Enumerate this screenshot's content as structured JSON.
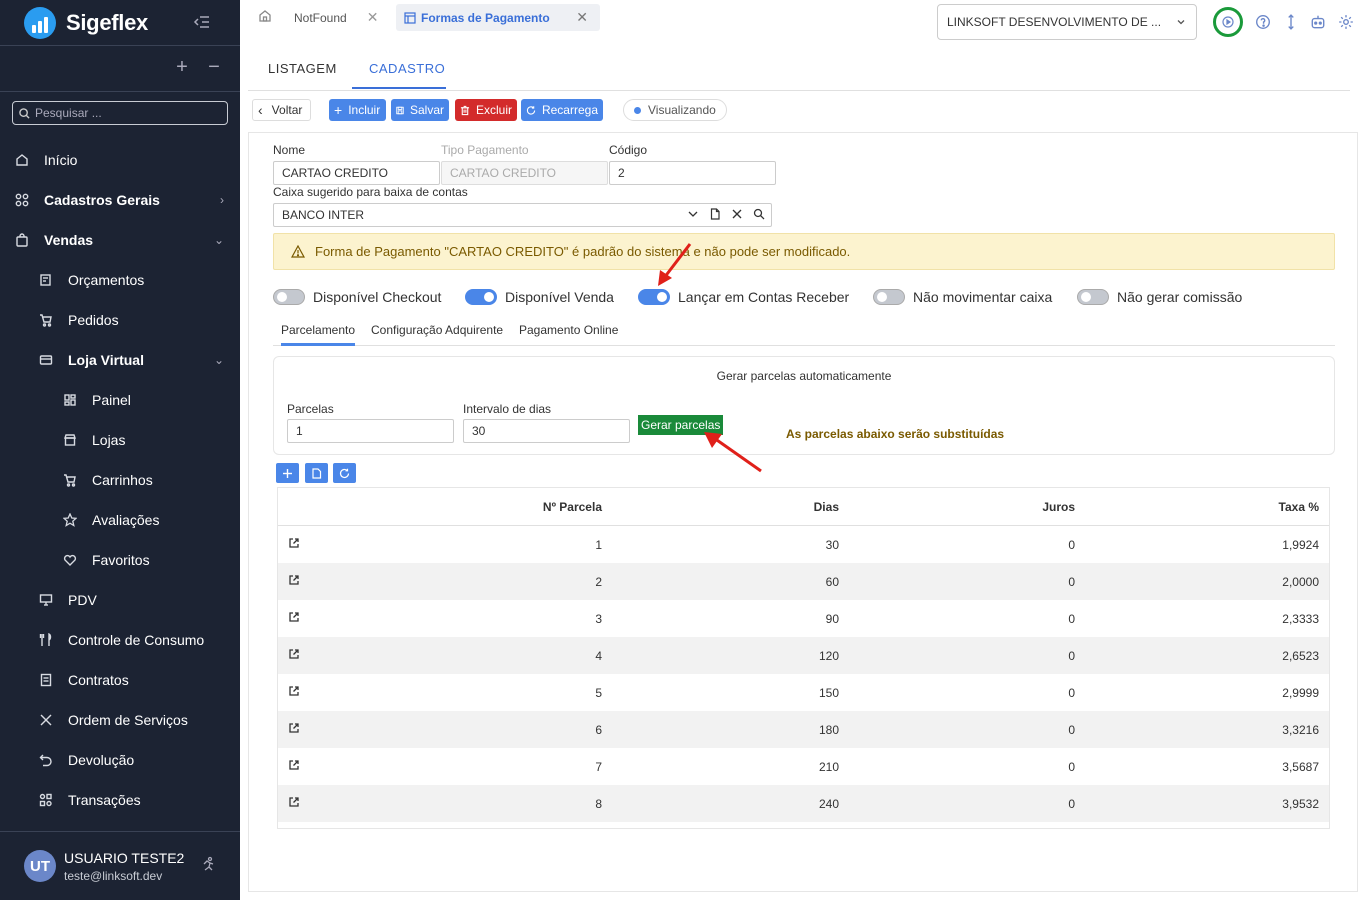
{
  "brand": {
    "name": "Sigeflex"
  },
  "sidebar": {
    "search_placeholder": "Pesquisar ...",
    "items": [
      {
        "label": "Início",
        "icon": "home-icon"
      },
      {
        "label": "Cadastros Gerais",
        "icon": "grid-icon"
      },
      {
        "label": "Vendas",
        "icon": "bag-icon"
      },
      {
        "label": "Orçamentos",
        "icon": "edit-doc-icon"
      },
      {
        "label": "Pedidos",
        "icon": "cart-icon"
      },
      {
        "label": "Loja Virtual",
        "icon": "store-card-icon"
      },
      {
        "label": "Painel",
        "icon": "dashboard-icon"
      },
      {
        "label": "Lojas",
        "icon": "storefront-icon"
      },
      {
        "label": "Carrinhos",
        "icon": "cart-icon"
      },
      {
        "label": "Avaliações",
        "icon": "star-icon"
      },
      {
        "label": "Favoritos",
        "icon": "heart-icon"
      },
      {
        "label": "PDV",
        "icon": "monitor-icon"
      },
      {
        "label": "Controle de Consumo",
        "icon": "utensils-icon"
      },
      {
        "label": "Contratos",
        "icon": "document-icon"
      },
      {
        "label": "Ordem de Serviços",
        "icon": "tools-icon"
      },
      {
        "label": "Devolução",
        "icon": "undo-icon"
      },
      {
        "label": "Transações",
        "icon": "transactions-icon"
      }
    ],
    "user": {
      "initials": "UT",
      "name": "USUARIO TESTE2",
      "email": "teste@linksoft.dev"
    }
  },
  "topbar": {
    "tabs": [
      {
        "label": "NotFound"
      },
      {
        "label": "Formas de Pagamento"
      }
    ],
    "company": "LINKSOFT DESENVOLVIMENTO DE ..."
  },
  "main_tabs": {
    "list": "LISTAGEM",
    "form": "CADASTRO"
  },
  "toolbar": {
    "back": "Voltar",
    "add": "Incluir",
    "save": "Salvar",
    "delete": "Excluir",
    "reload": "Recarrega",
    "status": "Visualizando"
  },
  "form": {
    "name_label": "Nome",
    "name_value": "CARTAO CREDITO",
    "type_label": "Tipo Pagamento",
    "type_value": "CARTAO CREDITO",
    "code_label": "Código",
    "code_value": "2",
    "cash_label": "Caixa sugerido para baixa de contas",
    "cash_value": "BANCO INTER",
    "alert": "Forma de Pagamento \"CARTAO CREDITO\" é padrão do sistema e não pode ser modificado.",
    "toggles": [
      {
        "label": "Disponível Checkout",
        "on": false
      },
      {
        "label": "Disponível Venda",
        "on": true
      },
      {
        "label": "Lançar em Contas Receber",
        "on": true
      },
      {
        "label": "Não movimentar caixa",
        "on": false
      },
      {
        "label": "Não gerar comissão",
        "on": false
      }
    ],
    "subtabs": [
      "Parcelamento",
      "Configuração Adquirente",
      "Pagamento Online"
    ]
  },
  "generate": {
    "title": "Gerar parcelas automaticamente",
    "parcelas_label": "Parcelas",
    "parcelas_value": "1",
    "interval_label": "Intervalo de dias",
    "interval_value": "30",
    "button": "Gerar parcelas",
    "warning": "As parcelas abaixo serão substituídas"
  },
  "grid": {
    "headers": [
      "Nº Parcela",
      "Dias",
      "Juros",
      "Taxa %"
    ],
    "rows": [
      [
        "1",
        "30",
        "0",
        "1,9924"
      ],
      [
        "2",
        "60",
        "0",
        "2,0000"
      ],
      [
        "3",
        "90",
        "0",
        "2,3333"
      ],
      [
        "4",
        "120",
        "0",
        "2,6523"
      ],
      [
        "5",
        "150",
        "0",
        "2,9999"
      ],
      [
        "6",
        "180",
        "0",
        "3,3216"
      ],
      [
        "7",
        "210",
        "0",
        "3,5687"
      ],
      [
        "8",
        "240",
        "0",
        "3,9532"
      ]
    ]
  },
  "colors": {
    "sidebar_bg": "#1c2333",
    "accent": "#4a86e8",
    "danger": "#d32b2b",
    "success": "#1a8a3a",
    "annotation": "#e0201a"
  }
}
